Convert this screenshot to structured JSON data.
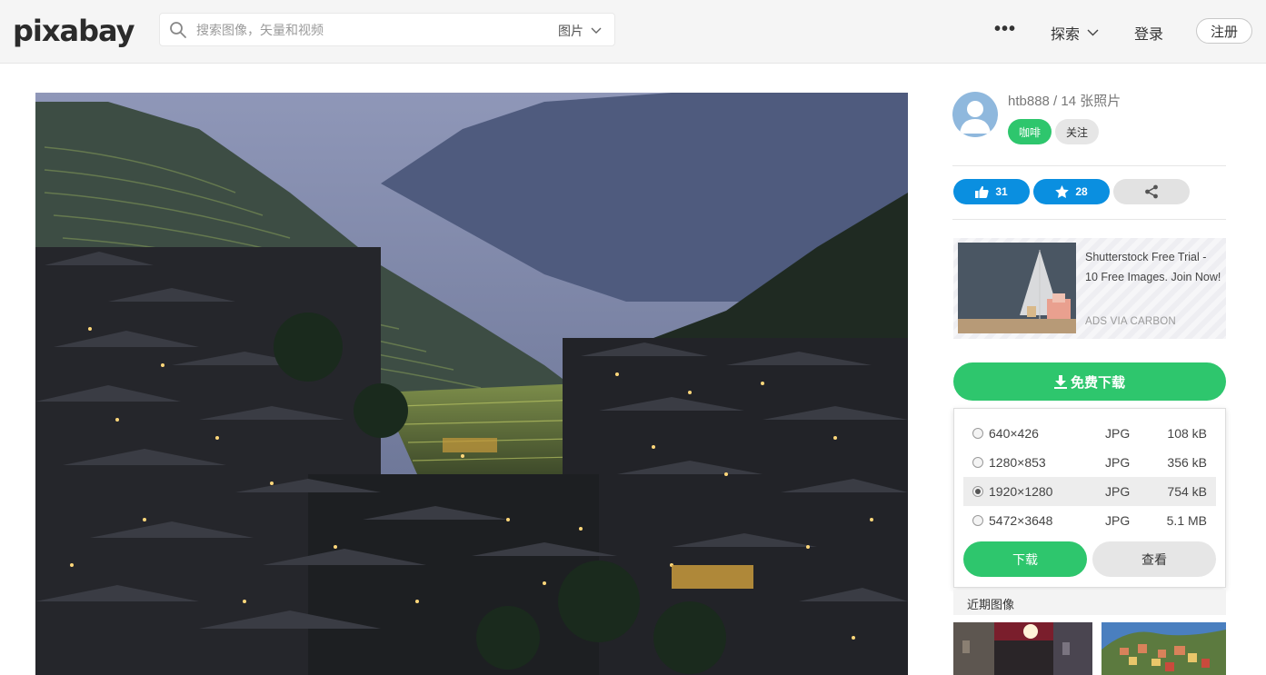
{
  "header": {
    "logo": "pixabay",
    "search_placeholder": "搜索图像，矢量和视频",
    "search_type": "图片",
    "more": "•••",
    "explore": "探索",
    "login": "登录",
    "register": "注册"
  },
  "user": {
    "line": "htb888 / 14 张照片",
    "coffee": "咖啡",
    "follow": "关注"
  },
  "stats": {
    "likes": "31",
    "favorites": "28"
  },
  "ad": {
    "text": "Shutterstock Free Trial - 10 Free Images. Join Now!",
    "via": "ADS VIA CARBON"
  },
  "download": {
    "main_label": "免费下载",
    "options": [
      {
        "resolution": "640×426",
        "format": "JPG",
        "size": "108 kB",
        "selected": false
      },
      {
        "resolution": "1280×853",
        "format": "JPG",
        "size": "356 kB",
        "selected": false
      },
      {
        "resolution": "1920×1280",
        "format": "JPG",
        "size": "754 kB",
        "selected": true
      },
      {
        "resolution": "5472×3648",
        "format": "JPG",
        "size": "5.1 MB",
        "selected": false
      }
    ],
    "download_button": "下载",
    "view_button": "查看"
  },
  "recent": {
    "label": "近期图像"
  },
  "colors": {
    "green": "#2ec66d",
    "blue": "#0a8fe0",
    "header_bg": "#f5f5f5"
  }
}
